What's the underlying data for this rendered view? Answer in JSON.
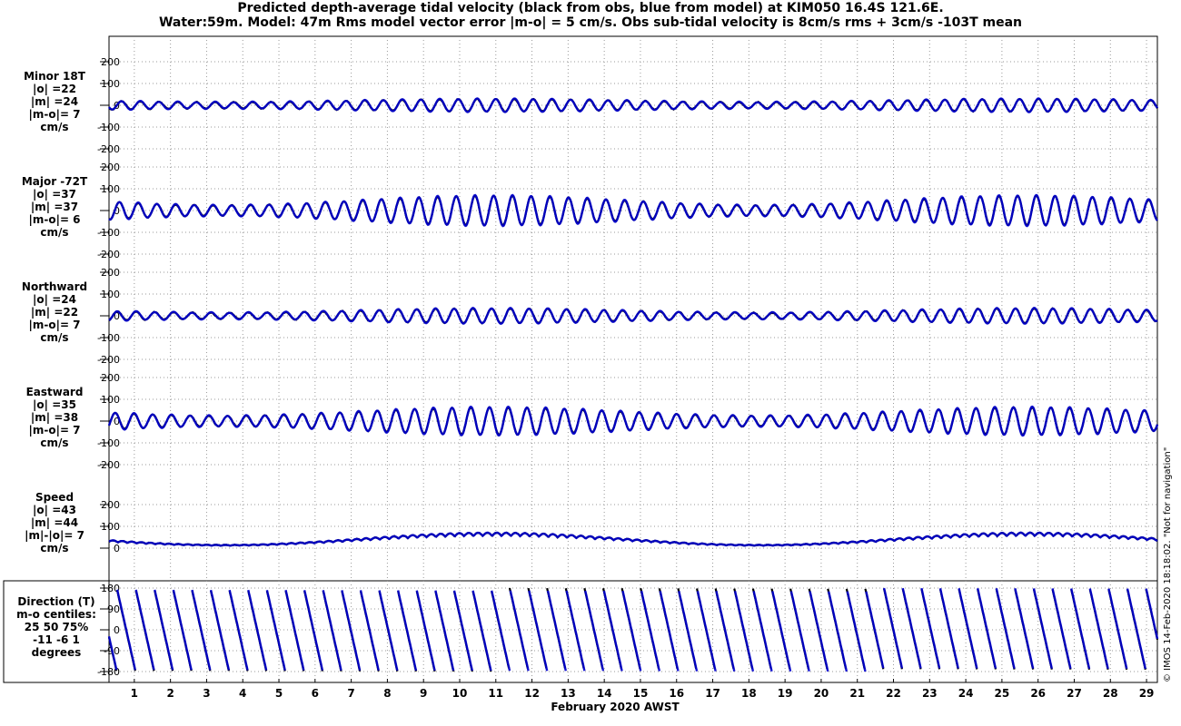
{
  "header": {
    "title_line1": "Predicted depth-average tidal velocity (black from obs, blue from model) at KIM050 16.4S 121.6E.",
    "title_line2": "Water:59m. Model: 47m  Rms model vector error |m-o| = 5 cm/s. Obs sub-tidal velocity is 8cm/s rms + 3cm/s -103T mean"
  },
  "footer": "© IMOS 14-Feb-2020 18:18:02. \"Not for navigation\"",
  "chart_data": {
    "type": "line",
    "xlabel": "February 2020 AWST",
    "x_ticks": [
      "1",
      "2",
      "3",
      "4",
      "5",
      "6",
      "7",
      "8",
      "9",
      "10",
      "11",
      "12",
      "13",
      "14",
      "15",
      "16",
      "17",
      "18",
      "19",
      "20",
      "21",
      "22",
      "23",
      "24",
      "25",
      "26",
      "27",
      "28",
      "29"
    ],
    "xlim_days": [
      0.3,
      29.3
    ],
    "series_names": [
      "obs",
      "model"
    ],
    "series_colors": {
      "obs": "#000000",
      "model": "#0000cc"
    },
    "grid": true,
    "panels": [
      {
        "label_lines": [
          "Minor 18T",
          "|o| =22",
          "|m| =24",
          "|m-o|= 7",
          "cm/s"
        ],
        "y_ticks": [
          "200",
          "100",
          "0",
          "-100",
          "-200"
        ],
        "ylim": [
          -200,
          200
        ],
        "amplitude_min": 15,
        "amplitude_max": 30
      },
      {
        "label_lines": [
          "Major -72T",
          "|o| =37",
          "|m| =37",
          "|m-o|= 6",
          "cm/s"
        ],
        "y_ticks": [
          "200",
          "100",
          "0",
          "-100",
          "-200"
        ],
        "ylim": [
          -200,
          200
        ],
        "amplitude_min": 25,
        "amplitude_max": 70
      },
      {
        "label_lines": [
          "Northward",
          "|o| =24",
          "|m| =22",
          "|m-o|= 7",
          "cm/s"
        ],
        "y_ticks": [
          "200",
          "100",
          "0",
          "-100",
          "-200"
        ],
        "ylim": [
          -200,
          200
        ],
        "amplitude_min": 15,
        "amplitude_max": 35
      },
      {
        "label_lines": [
          "Eastward",
          "|o| =35",
          "|m| =38",
          "|m-o|= 7",
          "cm/s"
        ],
        "y_ticks": [
          "200",
          "100",
          "0",
          "-100",
          "-200"
        ],
        "ylim": [
          -200,
          200
        ],
        "amplitude_min": 25,
        "amplitude_max": 65
      },
      {
        "label_lines": [
          "Speed",
          "|o| =43",
          "|m| =44",
          "|m|-|o|= 7",
          "cm/s"
        ],
        "y_ticks": [
          "200",
          "100",
          "0"
        ],
        "ylim": [
          0,
          200
        ],
        "mean_min": 15,
        "mean_max": 60
      },
      {
        "label_lines": [
          "Direction  (T)",
          "m-o centiles:",
          "25  50  75%",
          "-11  -6   1",
          "degrees"
        ],
        "y_ticks": [
          "180",
          "90",
          "0",
          "-90",
          "-180"
        ],
        "ylim": [
          -180,
          180
        ]
      }
    ]
  }
}
